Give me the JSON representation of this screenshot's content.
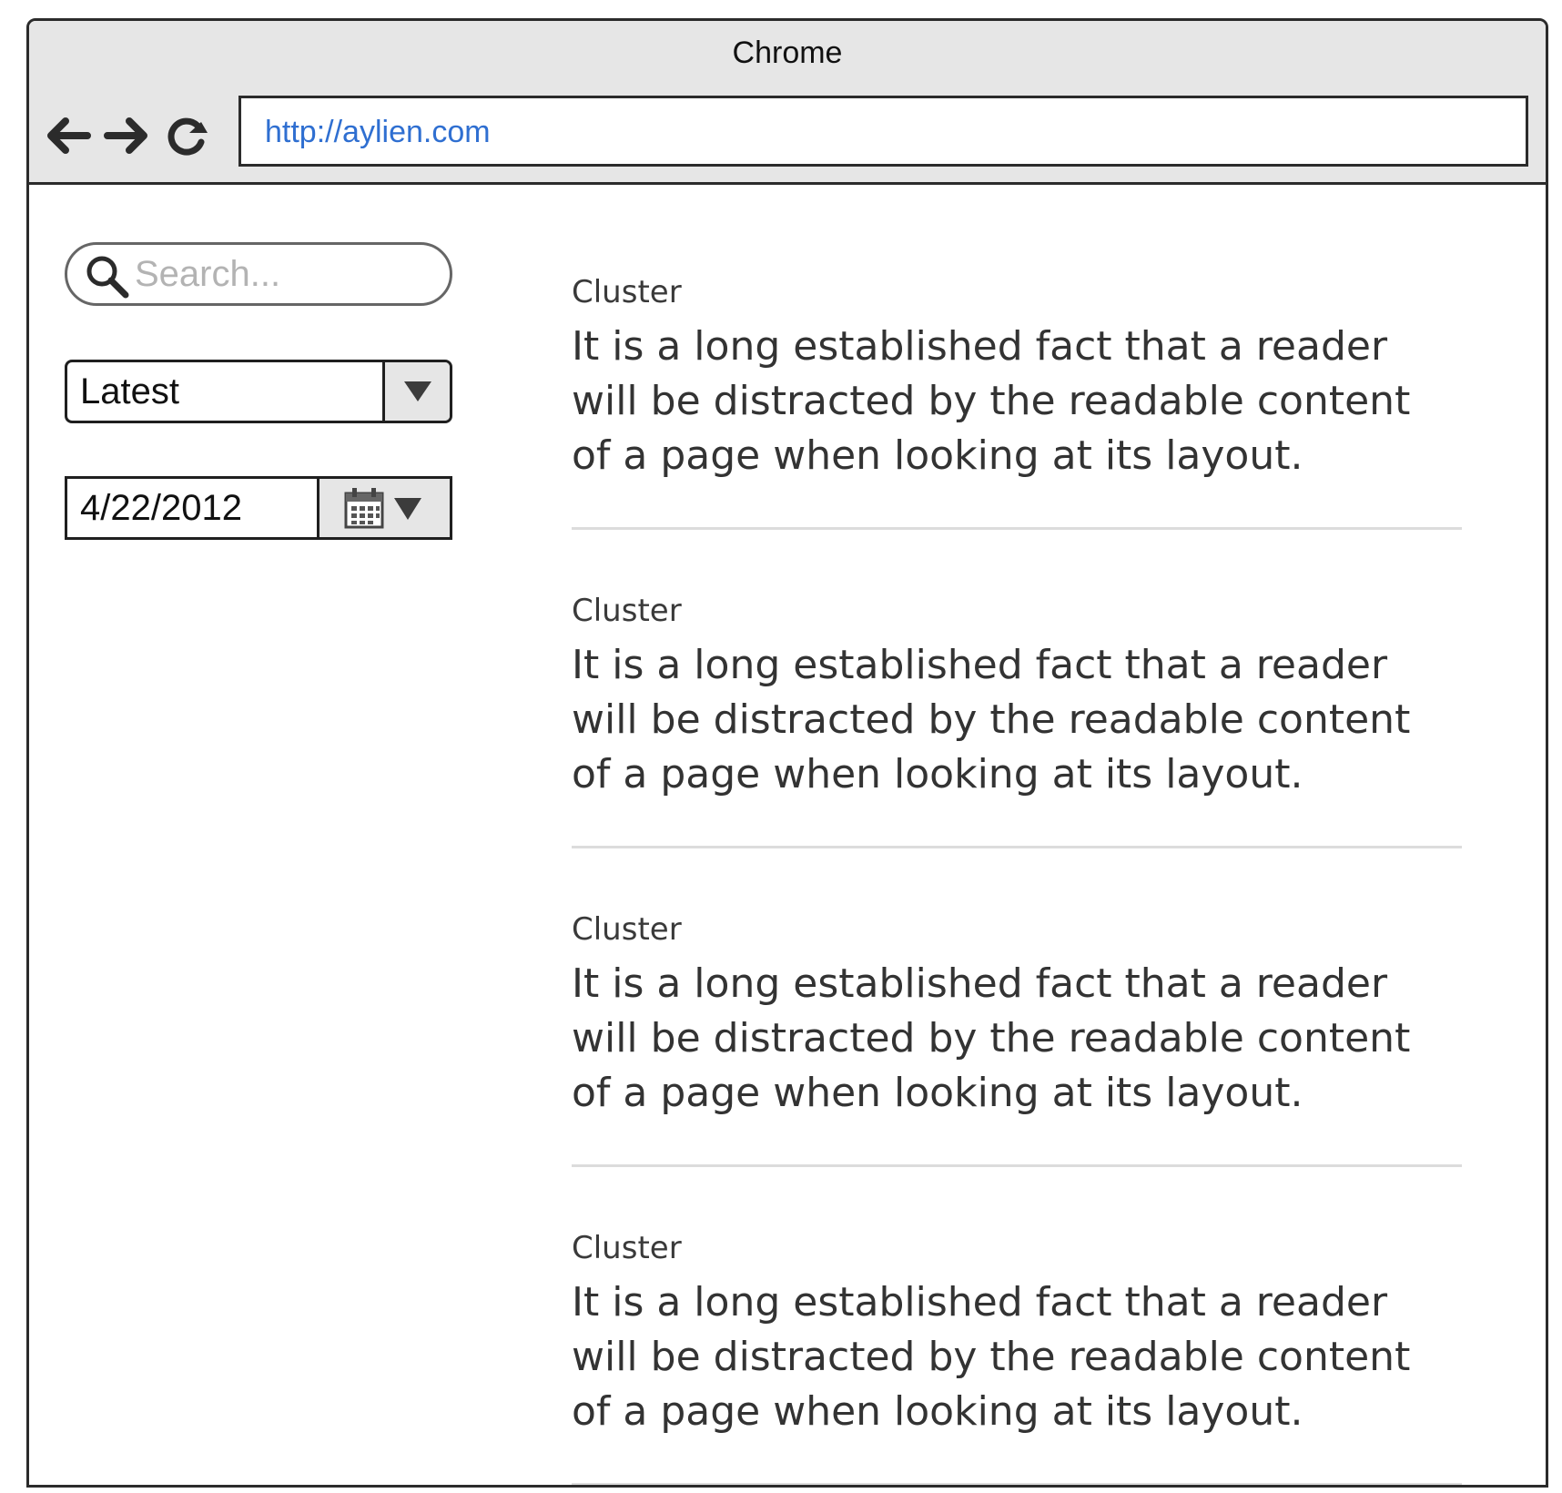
{
  "window": {
    "title": "Chrome"
  },
  "toolbar": {
    "back_icon": "back-arrow-icon",
    "forward_icon": "forward-arrow-icon",
    "reload_icon": "reload-icon",
    "url": "http://aylien.com"
  },
  "sidebar": {
    "search": {
      "icon": "search-icon",
      "placeholder": "Search..."
    },
    "sort_select": {
      "value": "Latest"
    },
    "date_picker": {
      "value": "4/22/2012",
      "icon": "calendar-icon"
    }
  },
  "clusters": [
    {
      "label": "Cluster",
      "text": "It is a long established fact that a reader will be distracted by the readable content of a page when looking at its layout."
    },
    {
      "label": "Cluster",
      "text": "It is a long established fact that a reader will be distracted by the readable content of a page when looking at its layout."
    },
    {
      "label": "Cluster",
      "text": "It is a long established fact that a reader will be distracted by the readable content of a page when looking at its layout."
    },
    {
      "label": "Cluster",
      "text": "It is a long established fact that a reader will be distracted by the readable content of a page when looking at its layout."
    }
  ],
  "colors": {
    "url_text": "#2f6fd1",
    "titlebar_bg": "#e6e6e6",
    "divider": "#dcdcdc"
  }
}
